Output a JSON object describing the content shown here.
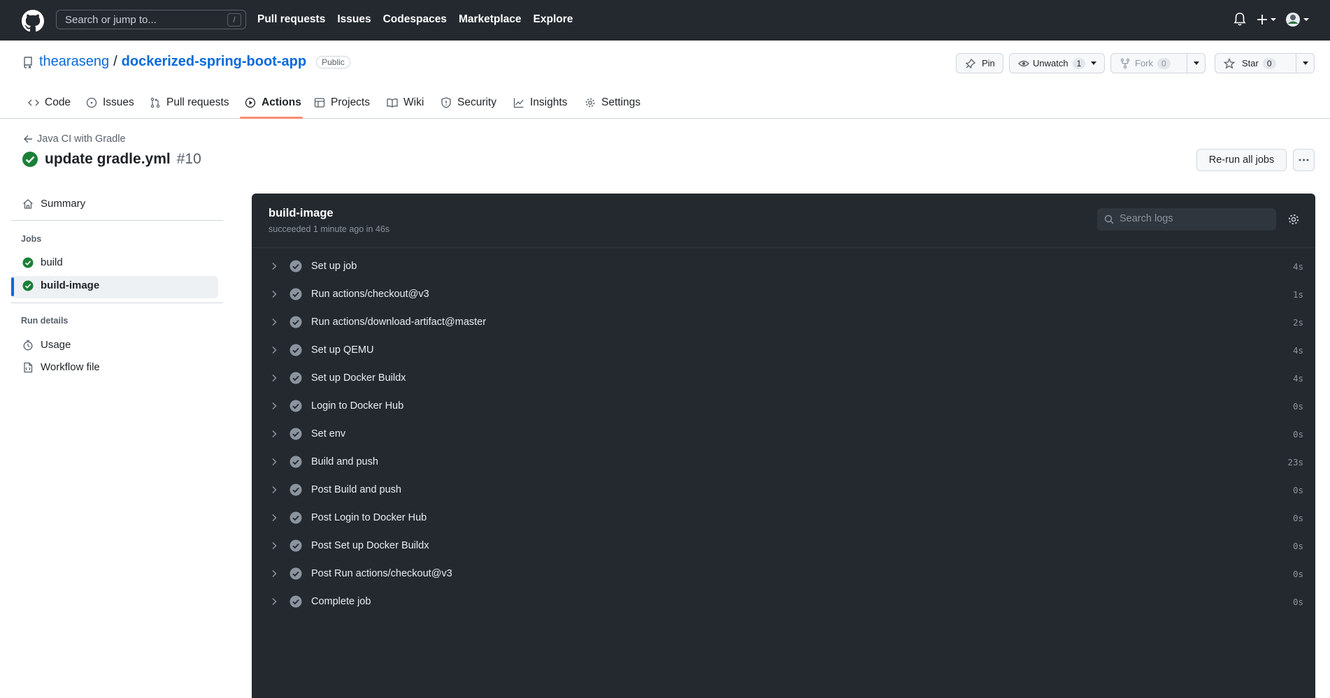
{
  "header": {
    "search_placeholder": "Search or jump to...",
    "search_shortcut": "/",
    "nav": [
      "Pull requests",
      "Issues",
      "Codespaces",
      "Marketplace",
      "Explore"
    ]
  },
  "repo": {
    "owner": "thearaseng",
    "separator": "/",
    "name": "dockerized-spring-boot-app",
    "visibility": "Public",
    "pin_label": "Pin",
    "unwatch_label": "Unwatch",
    "watch_count": "1",
    "fork_label": "Fork",
    "fork_count": "0",
    "star_label": "Star",
    "star_count": "0"
  },
  "tabs": [
    "Code",
    "Issues",
    "Pull requests",
    "Actions",
    "Projects",
    "Wiki",
    "Security",
    "Insights",
    "Settings"
  ],
  "run": {
    "workflow": "Java CI with Gradle",
    "title": "update gradle.yml",
    "number": "#10",
    "rerun_label": "Re-run all jobs"
  },
  "sidebar": {
    "summary": "Summary",
    "jobs_heading": "Jobs",
    "jobs": [
      "build",
      "build-image"
    ],
    "run_details_heading": "Run details",
    "usage": "Usage",
    "workflow_file": "Workflow file"
  },
  "log": {
    "job_name": "build-image",
    "status": "succeeded 1 minute ago in 46s",
    "search_placeholder": "Search logs",
    "steps": [
      {
        "name": "Set up job",
        "duration": "4s"
      },
      {
        "name": "Run actions/checkout@v3",
        "duration": "1s"
      },
      {
        "name": "Run actions/download-artifact@master",
        "duration": "2s"
      },
      {
        "name": "Set up QEMU",
        "duration": "4s"
      },
      {
        "name": "Set up Docker Buildx",
        "duration": "4s"
      },
      {
        "name": "Login to Docker Hub",
        "duration": "0s"
      },
      {
        "name": "Set env",
        "duration": "0s"
      },
      {
        "name": "Build and push",
        "duration": "23s"
      },
      {
        "name": "Post Build and push",
        "duration": "0s"
      },
      {
        "name": "Post Login to Docker Hub",
        "duration": "0s"
      },
      {
        "name": "Post Set up Docker Buildx",
        "duration": "0s"
      },
      {
        "name": "Post Run actions/checkout@v3",
        "duration": "0s"
      },
      {
        "name": "Complete job",
        "duration": "0s"
      }
    ]
  },
  "colors": {
    "header_bg": "#24292f",
    "link": "#0969da",
    "success": "#1a7f37",
    "active_tab": "#fd8c73",
    "log_bg": "#24292f"
  }
}
